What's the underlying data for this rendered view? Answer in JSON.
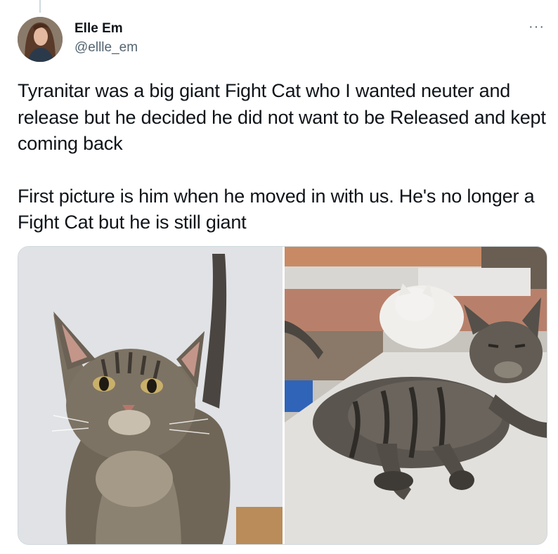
{
  "author": {
    "name": "Elle Em",
    "handle": "@ellle_em",
    "avatar_icon": "profile-photo"
  },
  "more_label": "···",
  "tweet": {
    "paragraph_1": "Tyranitar was a big giant Fight Cat who I wanted neuter and release but he decided he did not want to be Released and kept coming back",
    "paragraph_2": "First picture is him when he moved in with us. He's no longer a Fight Cat but he is still giant"
  },
  "media": {
    "photo_count": 2,
    "photo_1_subject": "tabby-cat-standing-indoors",
    "photo_2_subject": "tabby-cat-lying-outdoors"
  },
  "colors": {
    "text": "#0f1419",
    "secondary": "#536471",
    "border": "#cfd9de"
  }
}
